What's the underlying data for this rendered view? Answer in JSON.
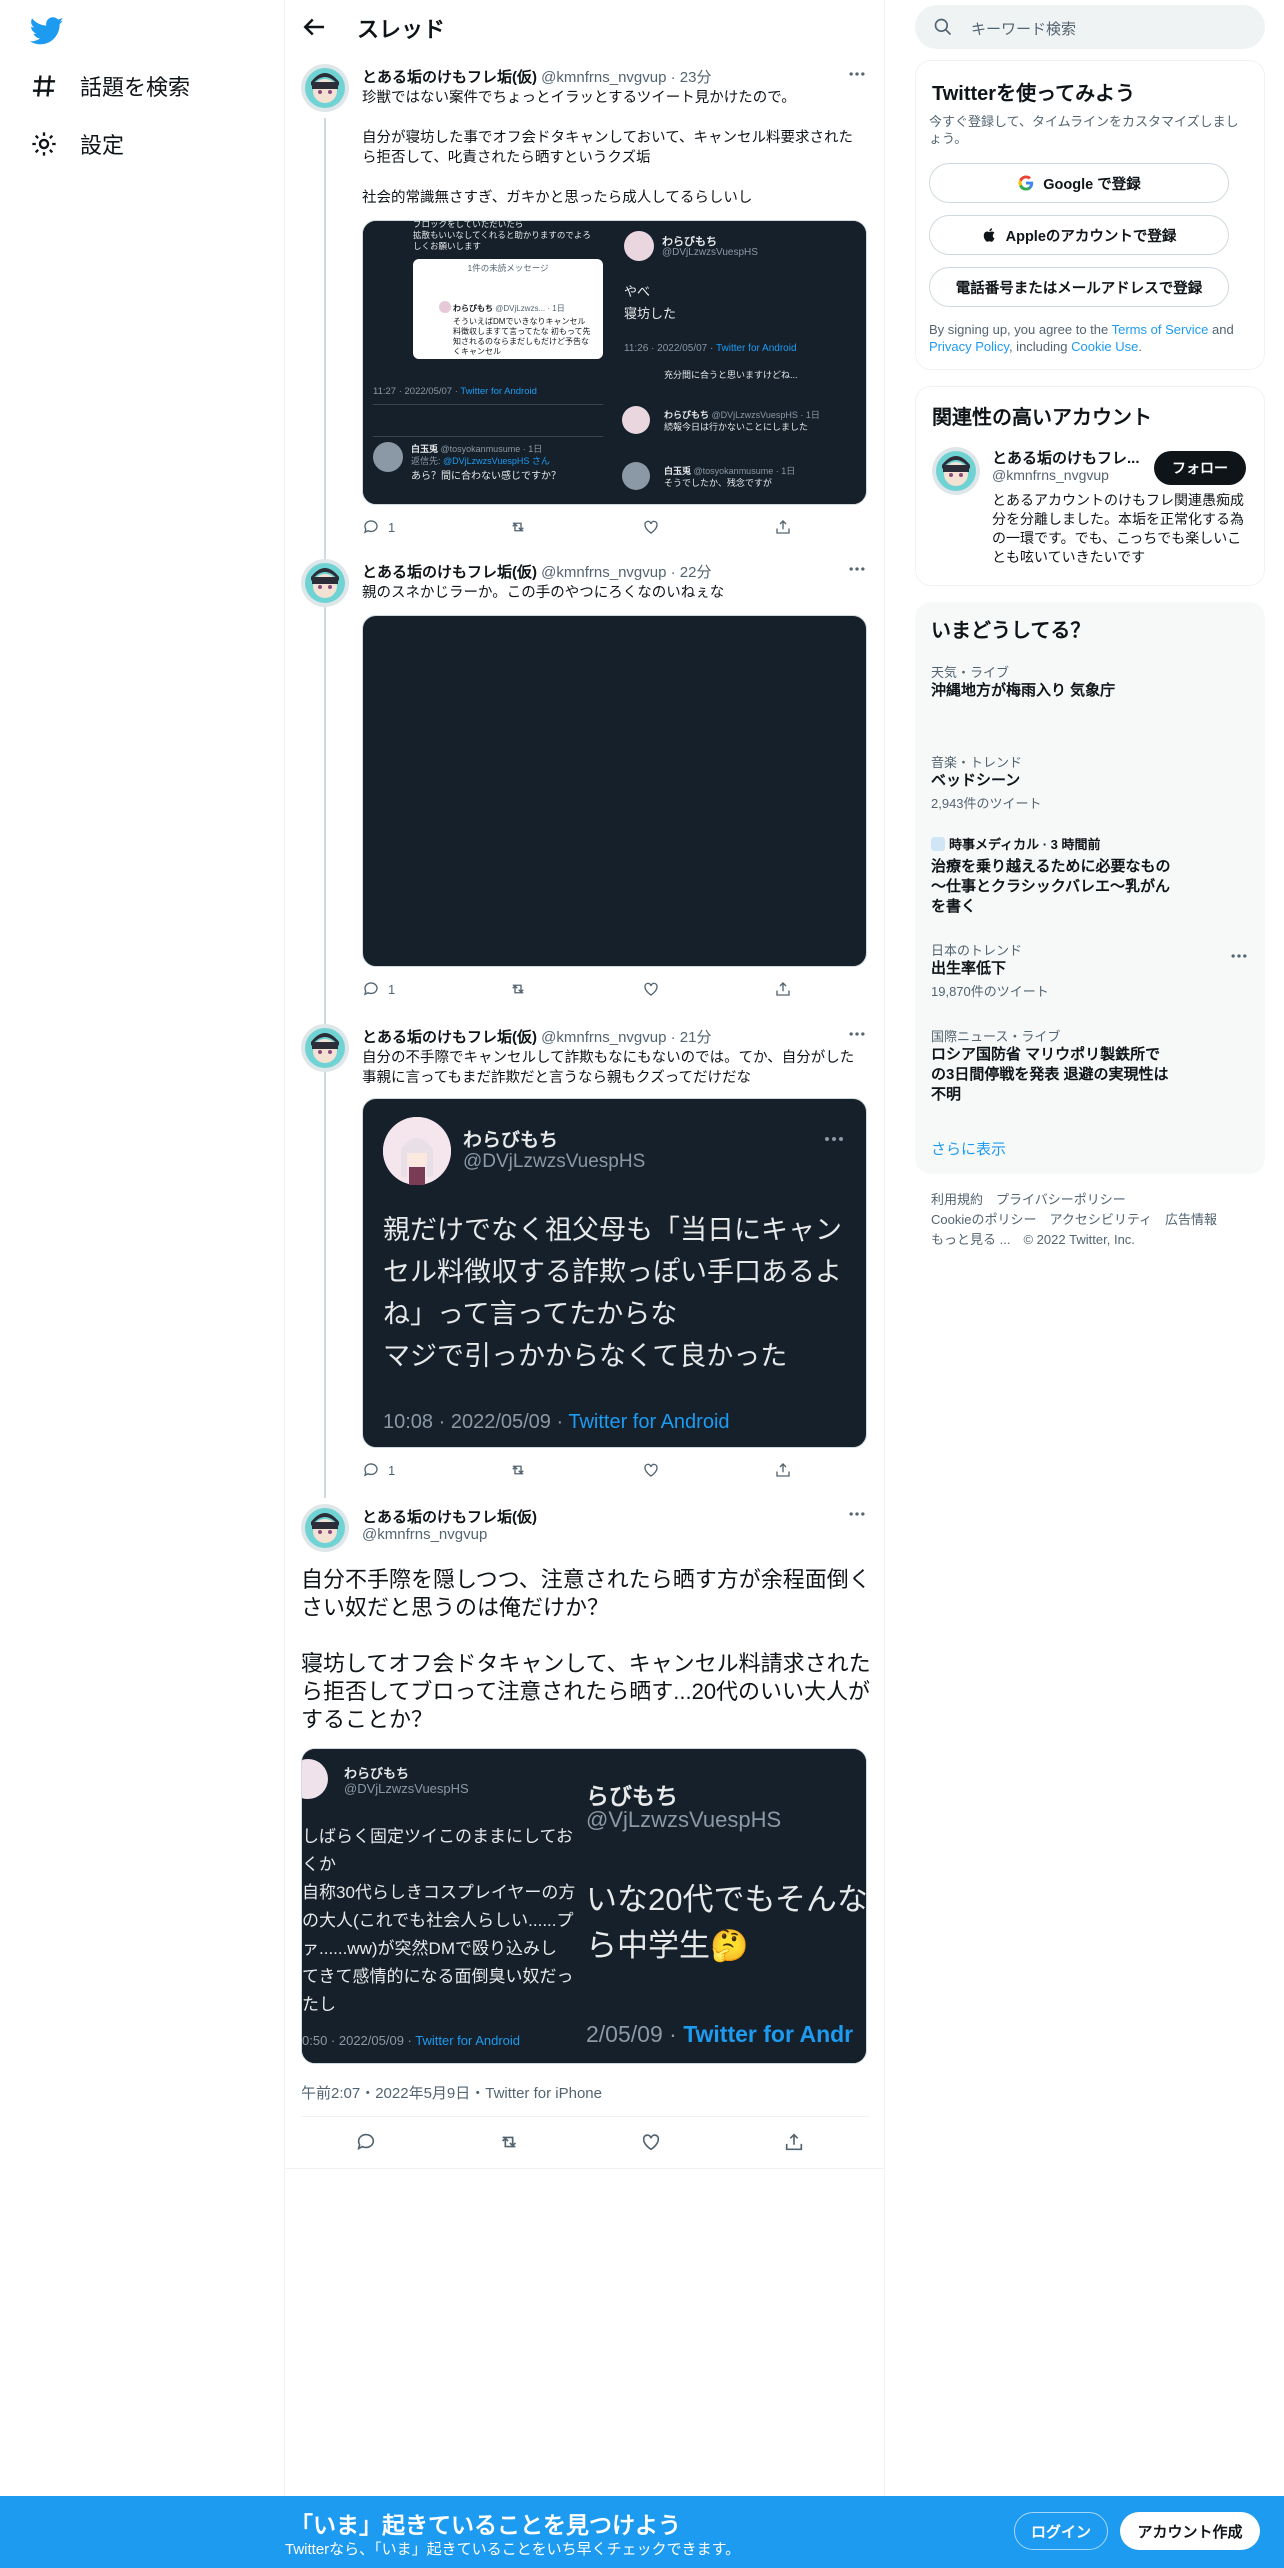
{
  "nav": {
    "explore": "話題を検索",
    "settings": "設定"
  },
  "header": {
    "title": "スレッド"
  },
  "author": {
    "name": "とある垢のけもフレ垢(仮)",
    "handle": "@kmnfrns_nvgvup"
  },
  "tweets": [
    {
      "time": "· 23分",
      "text": "珍獣ではない案件でちょっとイラッとするツイート見かけたので。\n\n自分が寝坊した事でオフ会ドタキャンしておいて、キャンセル料要求されたら拒否して、叱責されたら晒すというクズ垢\n\n社会的常識無さすぎ、ガキかと思ったら成人してるらしいし",
      "reply_count": "1"
    },
    {
      "time": "· 22分",
      "text": "親のスネかじラーか。この手のやつにろくなのいねぇな",
      "reply_count": "1"
    },
    {
      "time": "· 21分",
      "text": "自分の不手際でキャンセルして詐欺もなにもないのでは。てか、自分がした事親に言ってもまだ詐欺だと言うなら親もクズってだけだな",
      "reply_count": "1"
    }
  ],
  "media1": {
    "dm_title": "1件の未読メッセージ",
    "dm_name": "わらびもち",
    "dm_handle": "@DVjLzwzs... · 1日",
    "dm_body": "そういえばDMでいきなりキャンセル料徴収しますて言ってたな 初もって先知されるのならまだしもだけど予告なくキャンセル",
    "top_text": "ブロックをしていただいたら\n拡散もいいなしてくれると助かりますのでよろしくお願いします",
    "right_name": "わらびもち",
    "right_handle": "@DVjLzwzsVuespHS",
    "right_text": "やべ\n寝坊した",
    "right_time": "11:26 · 2022/05/07 · ",
    "source": "Twitter for Android",
    "bl_time": "11:27 · 2022/05/07 · ",
    "bl_reply_name": "白玉兎",
    "bl_reply_handle": "@tosyokanmusume · 1日",
    "bl_reply_to": "返信先: ",
    "bl_reply_to_handle": "@DVjLzwzsVuespHS さん",
    "bl_reply_text": "あら？間に合わない感じですか？",
    "br_text1": "充分間に合うと思いますけどね...",
    "br_name2": "わらびもち",
    "br_handle2": "@DVjLzwzsVuespHS · 1日",
    "br_text2": "続報今日は行かないことにしました",
    "br_name3": "白玉兎",
    "br_handle3": "@tosyokanmusume · 1日",
    "br_text3": "そうでしたか、残念ですが"
  },
  "quote": {
    "name": "わらびもち",
    "handle": "@DVjLzwzsVuespHS",
    "text": "親だけでなく祖父母も「当日にキャンセル料徴収する詐欺っぽい手口あるよね」って言ってたからな\nマジで引っかからなくて良かった",
    "time": "10:08 · 2022/05/09 · ",
    "source": "Twitter for Android"
  },
  "focal": {
    "text": "自分不手際を隠しつつ、注意されたら晒す方が余程面倒くさい奴だと思うのは俺だけか？\n\n寝坊してオフ会ドタキャンして、キャンセル料請求されたら拒否してブロって注意されたら晒す...20代のいい大人がすることか？",
    "meta": "午前2:07・2022年5月9日・Twitter for iPhone",
    "img_left_name": "わらびもち",
    "img_left_handle": "@DVjLzwzsVuespHS",
    "img_left_text": "しばらく固定ツイこのままにしておくか\n自称30代らしきコスプレイヤーの方\nの大人(これでも社会人らしい......プ\nァ......ww)が突然DMで殴り込みし\nてきて感情的になる面倒臭い奴だっ\nたし",
    "img_left_time": "0:50 · 2022/05/09 · ",
    "img_right_name": "らびもち",
    "img_right_handle": "@VjLzwzsVuespHS",
    "img_right_text": "いな20代でもそんな\nら中学生🤔",
    "img_right_time": "2/05/09 · ",
    "img_right_source": "Twitter for Andr"
  },
  "right": {
    "search_placeholder": "キーワード検索",
    "signup_title": "Twitterを使ってみよう",
    "signup_sub": "今すぐ登録して、タイムラインをカスタマイズしましょう。",
    "google_btn": "Google で登録",
    "apple_btn": "Appleのアカウントで登録",
    "phone_btn": "電話番号またはメールアドレスで登録",
    "tos_pre": "By signing up, you agree to the ",
    "tos_link": "Terms of Service",
    "tos_and": " and ",
    "privacy_link": "Privacy Policy",
    "tos_incl": ", including ",
    "cookie_link": "Cookie Use",
    "tos_end": ".",
    "related_title": "関連性の高いアカウント",
    "related_name": "とある垢のけもフレ...",
    "related_handle": "@kmnfrns_nvgvup",
    "related_bio": "とあるアカウントのけもフレ関連愚痴成分を分離しました。本垢を正常化する為の一環です。でも、こっちでも楽しいことも呟いていきたいです",
    "follow_btn": "フォロー",
    "trends_title": "いまどうしてる？",
    "trends": [
      {
        "cat": "天気・ライブ",
        "title": "沖縄地方が梅雨入り 気象庁",
        "count": ""
      },
      {
        "cat": "音楽・トレンド",
        "title": "ベッドシーン",
        "count": "2,943件のツイート"
      },
      {
        "cat": "時事メディカル · 3 時間前",
        "title": "治療を乗り越えるために必要なもの～仕事とクラシックバレエ～乳がんを書く",
        "count": ""
      },
      {
        "cat": "日本のトレンド",
        "title": "出生率低下",
        "count": "19,870件のツイート"
      },
      {
        "cat": "国際ニュース・ライブ",
        "title": "ロシア国防省 マリウポリ製鉄所での3日間停戦を発表 退避の実現性は不明",
        "count": ""
      }
    ],
    "show_more": "さらに表示",
    "footer_line1": "利用規約　プライバシーポリシー",
    "footer_line2": "Cookieのポリシー　アクセシビリティ　広告情報",
    "footer_line3": "もっと見る ...　© 2022 Twitter, Inc."
  },
  "bottom": {
    "title": "「いま」起きていることを見つけよう",
    "sub": "Twitterなら、「いま」起きていることをいち早くチェックできます。",
    "login": "ログイン",
    "signup": "アカウント作成"
  },
  "colors": {
    "accent": "#1d9bf0",
    "text": "#0f1419",
    "muted": "#536471",
    "media_bg": "#15202b"
  }
}
